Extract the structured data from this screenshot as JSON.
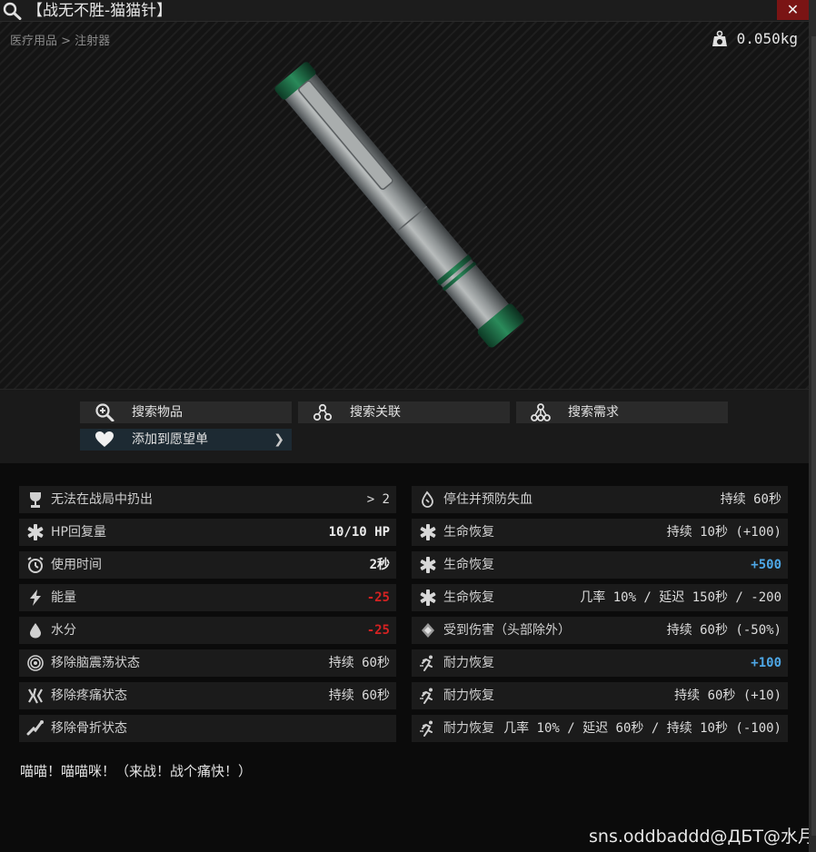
{
  "window": {
    "title": "【战无不胜-猫猫针】",
    "close_label": "✕"
  },
  "image_panel": {
    "breadcrumb": "医疗用品 > 注射器",
    "weight": "0.050kg"
  },
  "actions": {
    "search_items": "搜索物品",
    "search_related": "搜索关联",
    "search_needs": "搜索需求",
    "add_wishlist": "添加到愿望单"
  },
  "stats_left": [
    {
      "icon": "trophy-icon",
      "label": "无法在战局中扔出",
      "value": "> 2"
    },
    {
      "icon": "medical-cross-icon",
      "label": "HP回复量",
      "value": "10/10 HP"
    },
    {
      "icon": "alarm-clock-icon",
      "label": "使用时间",
      "value": "2秒"
    },
    {
      "icon": "lightning-icon",
      "label": "能量",
      "value": "-25"
    },
    {
      "icon": "water-drop-icon",
      "label": "水分",
      "value": "-25"
    },
    {
      "icon": "concussion-icon",
      "label": "移除脑震荡状态",
      "value": "持续 60秒"
    },
    {
      "icon": "pain-icon",
      "label": "移除疼痛状态",
      "value": "持续 60秒"
    },
    {
      "icon": "fracture-icon",
      "label": "移除骨折状态",
      "value": ""
    }
  ],
  "stats_right": [
    {
      "icon": "bleeding-icon",
      "label": "停住并预防失血",
      "value": "持续 60秒"
    },
    {
      "icon": "medical-cross-icon",
      "label": "生命恢复",
      "value": "持续 10秒 (+100)"
    },
    {
      "icon": "medical-cross-icon",
      "label": "生命恢复",
      "value": "+500"
    },
    {
      "icon": "medical-cross-icon",
      "label": "生命恢复",
      "value": "几率 10% / 延迟 150秒 / -200"
    },
    {
      "icon": "damage-shield-icon",
      "label": "受到伤害（头部除外）",
      "value": "持续 60秒 (-50%)"
    },
    {
      "icon": "stamina-icon",
      "label": "耐力恢复",
      "value": "+100"
    },
    {
      "icon": "stamina-icon",
      "label": "耐力恢复",
      "value": "持续 60秒 (+10)"
    },
    {
      "icon": "stamina-icon",
      "label": "耐力恢复",
      "value": "几率 10% / 延迟 60秒 / 持续 10秒 (-100)"
    }
  ],
  "description": "喵喵！喵喵咪！（来战！战个痛快！）",
  "watermark": "sns.oddbaddd@ДБТ@水月",
  "colors": {
    "positive": "#4ea7e6",
    "negative": "#d42222",
    "close": "#7a1414",
    "row_bg": "#1b1b1b"
  }
}
